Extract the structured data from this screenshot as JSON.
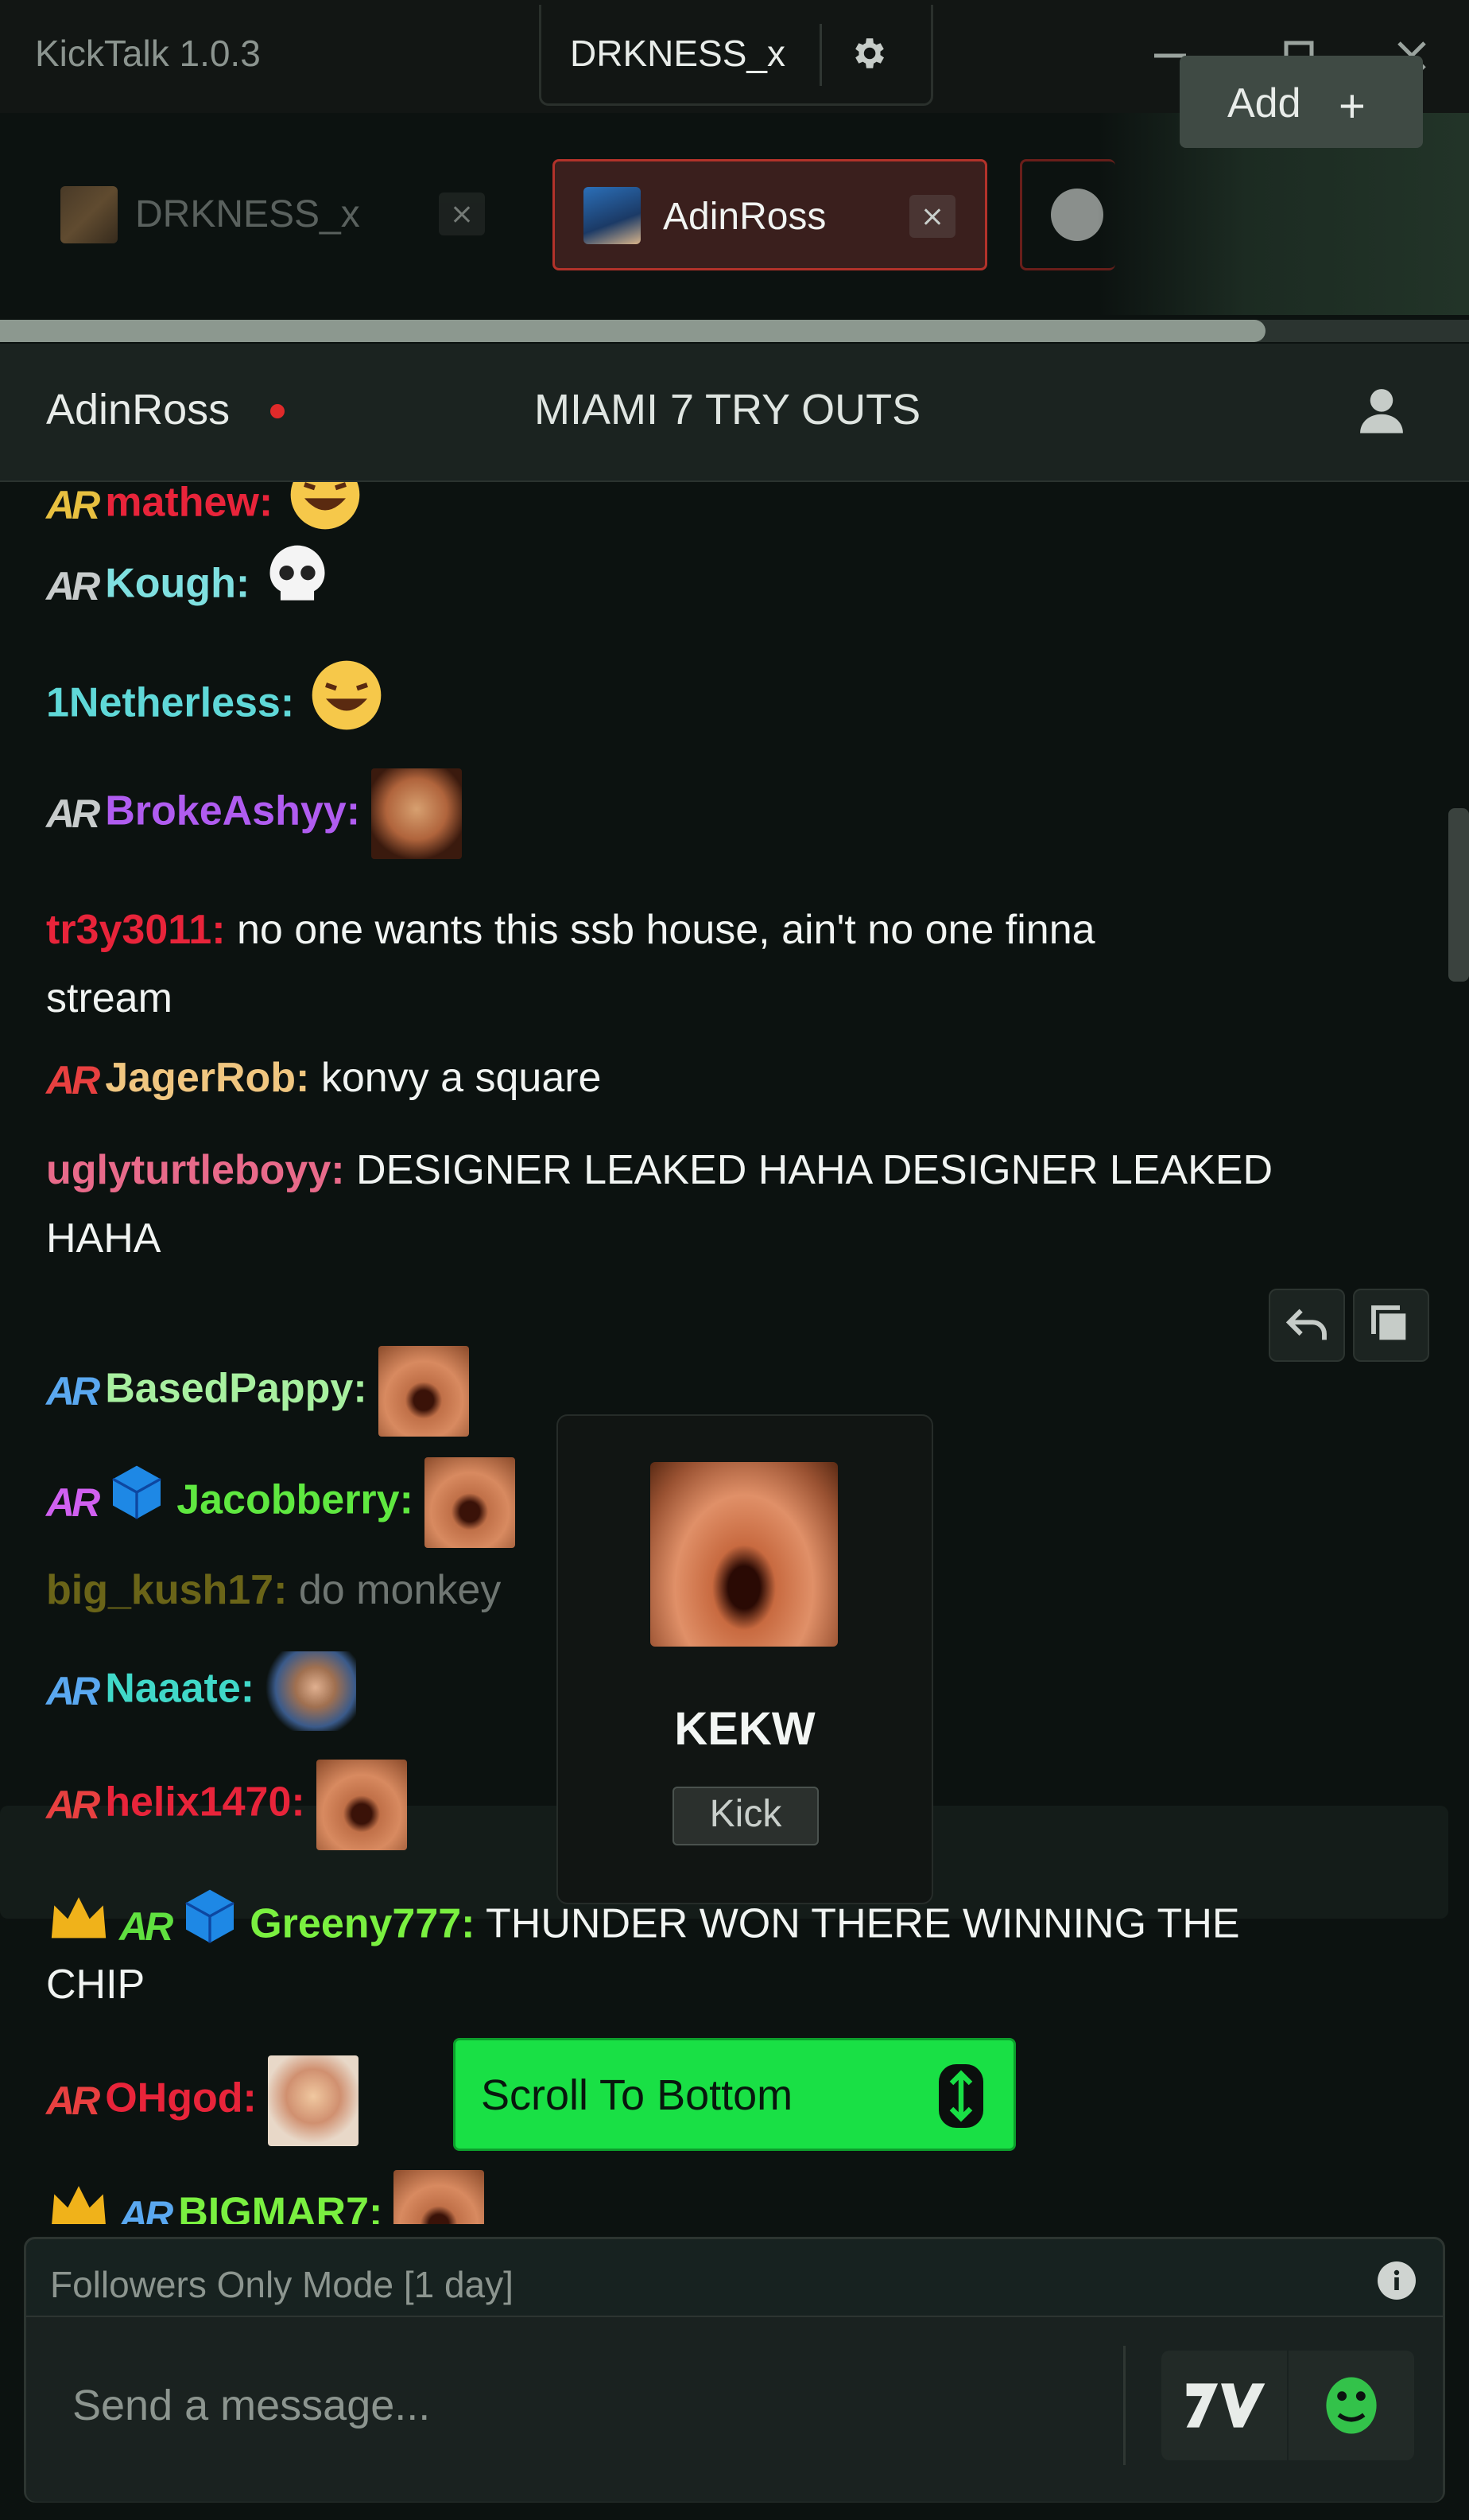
{
  "app": {
    "title": "KickTalk 1.0.3",
    "username": "DRKNESS_x"
  },
  "tabs": [
    {
      "label": "DRKNESS_x",
      "active": false
    },
    {
      "label": "AdinRoss",
      "active": true
    },
    {
      "label": "",
      "active": false
    }
  ],
  "add_button": {
    "label": "Add"
  },
  "channel": {
    "name": "AdinRoss",
    "stream_title": "MIAMI 7 TRY OUTS"
  },
  "messages": [
    {
      "user": "mathew:",
      "color": "#e8243a",
      "text": "",
      "badge": "AR"
    },
    {
      "user": "Kough:",
      "color": "#7fe0e0",
      "text": "",
      "badge": "AR"
    },
    {
      "user": "1Netherless:",
      "color": "#5fd8d8",
      "text": ""
    },
    {
      "user": "BrokeAshyy:",
      "color": "#b05cf0",
      "text": "",
      "badge": "AR"
    },
    {
      "user": "tr3y3011:",
      "color": "#e8243a",
      "text": "no one wants this ssb house, ain't no one finna",
      "text2": "stream"
    },
    {
      "user": "JagerRob:",
      "color": "#f0c680",
      "text": "konvy a square",
      "badge": "AR"
    },
    {
      "user": "uglyturtleboyy:",
      "color": "#e86a8a",
      "text": "DESIGNER LEAKED HAHA DESIGNER LEAKED",
      "text2": "HAHA"
    },
    {
      "user": "BasedPappy:",
      "color": "#a8f0a0",
      "text": "",
      "badge": "AR"
    },
    {
      "user": "Jacobberry:",
      "color": "#5fe840",
      "text": "",
      "badge": "AR"
    },
    {
      "user": "big_kush17:",
      "color": "#6a6418",
      "text": "do monkey"
    },
    {
      "user": "Naaate:",
      "color": "#40d8c8",
      "text": "",
      "badge": "AR"
    },
    {
      "user": "helix1470:",
      "color": "#e8243a",
      "text": "",
      "badge": "AR"
    },
    {
      "user": "Greeny777:",
      "color": "#7af040",
      "text": "THUNDER WON THERE WINNING THE",
      "text2": "CHIP",
      "badge": "AR"
    },
    {
      "user": "OHgod:",
      "color": "#e8243a",
      "text": "",
      "badge": "AR"
    },
    {
      "user": "BIGMAR7:",
      "color": "#7af040",
      "text": "",
      "badge": "AR"
    }
  ],
  "emote_popup": {
    "name": "KEKW",
    "source": "Kick"
  },
  "scroll_to_bottom": {
    "label": "Scroll To Bottom"
  },
  "chat_input": {
    "mode_notice": "Followers Only Mode [1 day]",
    "placeholder": "Send a message..."
  },
  "colors": {
    "accent_green": "#19e045",
    "live_red": "#e02a2a",
    "active_tab_border": "#b2322a"
  }
}
